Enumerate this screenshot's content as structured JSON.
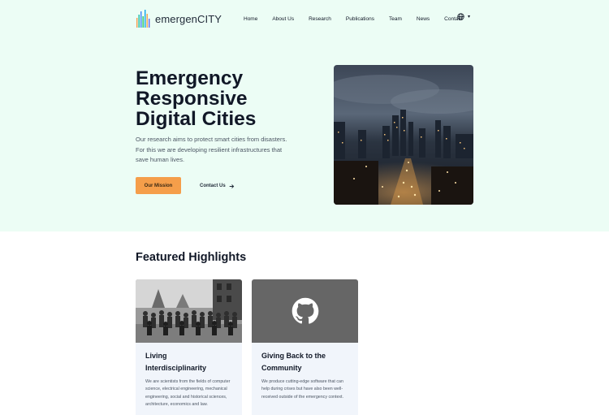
{
  "header": {
    "logo_text": "emergenCITY",
    "nav": [
      "Home",
      "About Us",
      "Research",
      "Publications",
      "Team",
      "News",
      "Contact"
    ],
    "language_icon": "globe-icon",
    "language_caret": "▾"
  },
  "hero": {
    "title_lines": [
      "Emergency",
      "Responsive",
      "Digital Cities"
    ],
    "description": "Our research aims to protect smart cities from disasters. For this we are developing resilient infrastructures that save human lives.",
    "primary_button": "Our Mission",
    "secondary_button": "Contact Us",
    "secondary_icon": "arrow-right-icon"
  },
  "featured": {
    "title": "Featured Highlights",
    "cards": [
      {
        "title_lines": [
          "Living",
          "Interdisciplinarity"
        ],
        "text": "We are scientists from the fields of computer science, electrical engineering, mechanical engineering, social and historical sciences, architecture, economics and law."
      },
      {
        "title_lines": [
          "Giving Back to the",
          "Community"
        ],
        "text": "We produce cutting-edge software that can help during crises but have also been well-received outside of the emergency context.",
        "icon": "github-icon"
      }
    ]
  },
  "colors": {
    "hero_background": "#ecfdf5",
    "primary_button": "#f59e4a",
    "card_background": "#f1f5fb",
    "github_card_background": "#666666"
  }
}
